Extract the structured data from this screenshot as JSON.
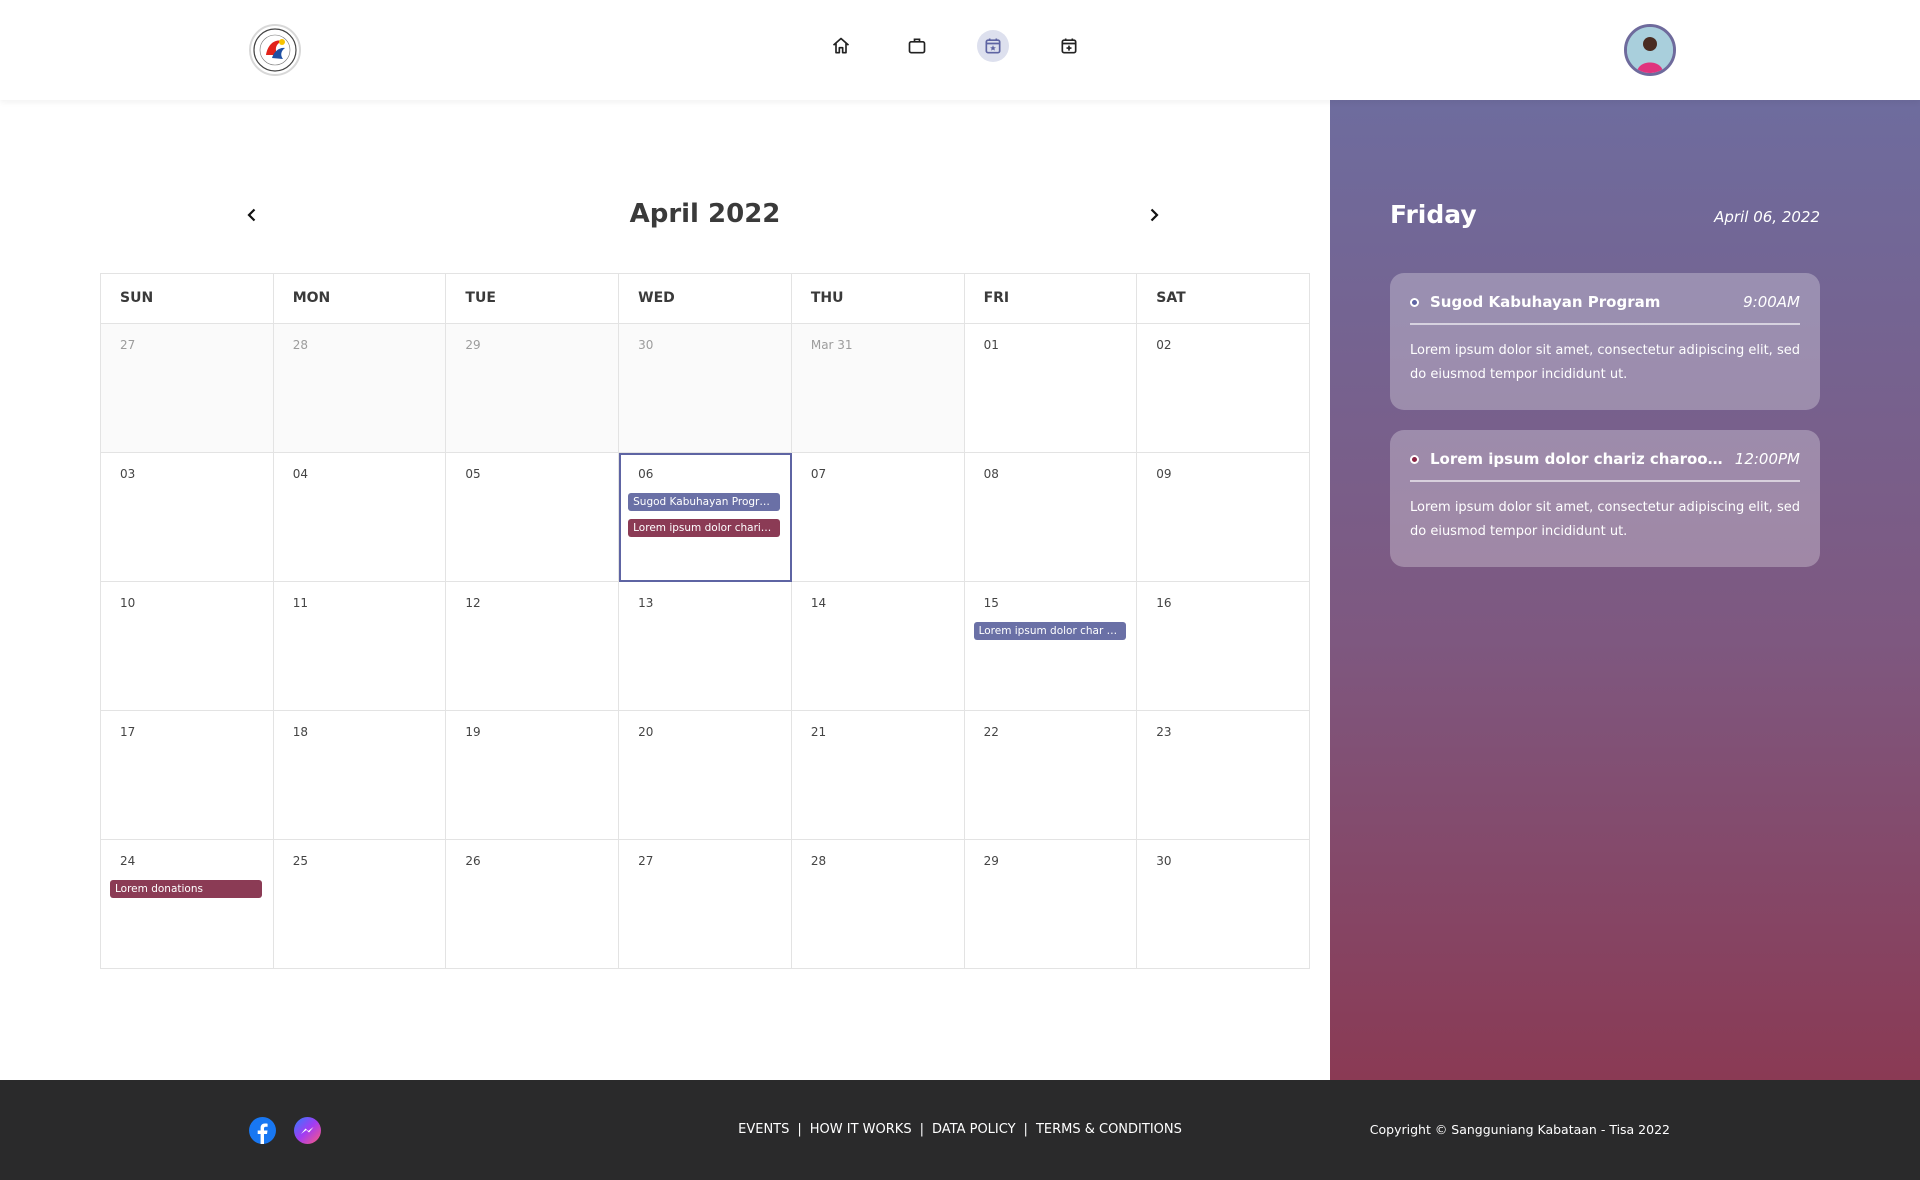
{
  "header": {
    "nav": [
      {
        "icon": "home-icon",
        "active": false
      },
      {
        "icon": "briefcase-icon",
        "active": false
      },
      {
        "icon": "calendar-star-icon",
        "active": true
      },
      {
        "icon": "calendar-plus-icon",
        "active": false
      }
    ]
  },
  "calendar": {
    "month_title": "April 2022",
    "weekdays": [
      "SUN",
      "MON",
      "TUE",
      "WED",
      "THU",
      "FRI",
      "SAT"
    ],
    "days": [
      {
        "label": "27",
        "muted": true
      },
      {
        "label": "28",
        "muted": true
      },
      {
        "label": "29",
        "muted": true
      },
      {
        "label": "30",
        "muted": true
      },
      {
        "label": "Mar 31",
        "muted": true
      },
      {
        "label": "01"
      },
      {
        "label": "02"
      },
      {
        "label": "03"
      },
      {
        "label": "04"
      },
      {
        "label": "05"
      },
      {
        "label": "06",
        "selected": true,
        "events": [
          {
            "title": "Sugod Kabuhayan Program",
            "color": "blue"
          },
          {
            "title": "Lorem ipsum dolor chariz...",
            "color": "red"
          }
        ]
      },
      {
        "label": "07"
      },
      {
        "label": "08"
      },
      {
        "label": "09"
      },
      {
        "label": "10"
      },
      {
        "label": "11"
      },
      {
        "label": "12"
      },
      {
        "label": "13"
      },
      {
        "label": "14"
      },
      {
        "label": "15",
        "events": [
          {
            "title": "Lorem ipsum dolor char ev...",
            "color": "blue"
          }
        ]
      },
      {
        "label": "16"
      },
      {
        "label": "17"
      },
      {
        "label": "18"
      },
      {
        "label": "19"
      },
      {
        "label": "20"
      },
      {
        "label": "21"
      },
      {
        "label": "22"
      },
      {
        "label": "23"
      },
      {
        "label": "24",
        "events": [
          {
            "title": "Lorem donations",
            "color": "red"
          }
        ]
      },
      {
        "label": "25"
      },
      {
        "label": "26"
      },
      {
        "label": "27"
      },
      {
        "label": "28"
      },
      {
        "label": "29"
      },
      {
        "label": "30"
      }
    ]
  },
  "side": {
    "day_name": "Friday",
    "date": "April 06, 2022",
    "events": [
      {
        "title": "Sugod Kabuhayan Program",
        "time": "9:00AM",
        "color": "blue",
        "description": "Lorem ipsum dolor sit amet, consectetur adipiscing elit, sed do eiusmod tempor incididunt ut."
      },
      {
        "title": "Lorem ipsum dolor chariz charoot prog...",
        "time": "12:00PM",
        "color": "red",
        "description": "Lorem ipsum dolor sit amet, consectetur adipiscing elit, sed do eiusmod tempor incididunt ut."
      }
    ]
  },
  "footer": {
    "social": [
      "facebook-icon",
      "messenger-icon"
    ],
    "links": [
      "EVENTS",
      "HOW IT WORKS",
      "DATA POLICY",
      "TERMS & CONDITIONS"
    ],
    "separator": "|",
    "copyright": "Copyright © Sangguniang Kabataan - Tisa 2022"
  },
  "colors": {
    "accent_blue": "#6a70a6",
    "accent_red": "#8b3b55",
    "footer_bg": "#2a2a2b"
  }
}
